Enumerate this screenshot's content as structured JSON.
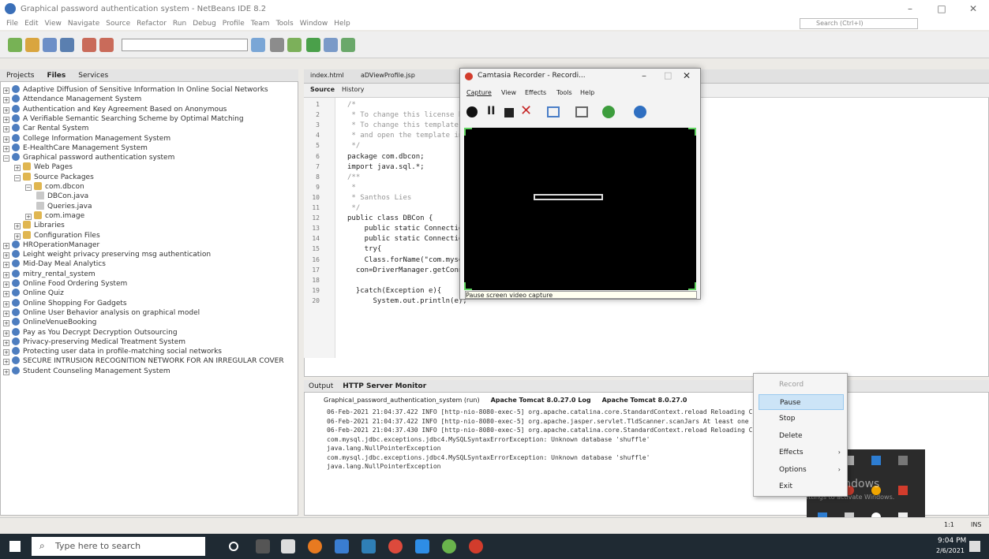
{
  "window": {
    "title": "Graphical password authentication system - NetBeans IDE 8.2"
  },
  "menu": [
    "File",
    "Edit",
    "View",
    "Navigate",
    "Source",
    "Refactor",
    "Run",
    "Debug",
    "Profile",
    "Team",
    "Tools",
    "Window",
    "Help"
  ],
  "search": {
    "placeholder": "Search (Ctrl+I)"
  },
  "projects": {
    "tabs": [
      "Projects",
      "Files",
      "Services"
    ],
    "items": [
      {
        "label": "Adaptive Diffusion of Sensitive Information In Online Social Networks",
        "level": 0
      },
      {
        "label": "Attendance Management System",
        "level": 0
      },
      {
        "label": "Authentication and Key Agreement Based on Anonymous",
        "level": 0
      },
      {
        "label": "A Verifiable Semantic Searching Scheme by Optimal Matching",
        "level": 0
      },
      {
        "label": "Car Rental System",
        "level": 0
      },
      {
        "label": "College Information Management System",
        "level": 0
      },
      {
        "label": "E-HealthCare Management System",
        "level": 0
      },
      {
        "label": "Graphical password authentication system",
        "level": 0
      },
      {
        "label": "Web Pages",
        "level": 1
      },
      {
        "label": "Source Packages",
        "level": 1
      },
      {
        "label": "com.dbcon",
        "level": 2
      },
      {
        "label": "DBCon.java",
        "level": 3
      },
      {
        "label": "Queries.java",
        "level": 3
      },
      {
        "label": "com.image",
        "level": 2
      },
      {
        "label": "Libraries",
        "level": 1
      },
      {
        "label": "Configuration Files",
        "level": 1
      },
      {
        "label": "HROperationManager",
        "level": 0
      },
      {
        "label": "Leight weight privacy preserving msg authentication",
        "level": 0
      },
      {
        "label": "Mid-Day Meal Analytics",
        "level": 0
      },
      {
        "label": "mitry_rental_system",
        "level": 0
      },
      {
        "label": "Online Food Ordering System",
        "level": 0
      },
      {
        "label": "Online Quiz",
        "level": 0
      },
      {
        "label": "Online Shopping For Gadgets",
        "level": 0
      },
      {
        "label": "Online User Behavior analysis on graphical model",
        "level": 0
      },
      {
        "label": "OnlineVenueBooking",
        "level": 0
      },
      {
        "label": "Pay as You Decrypt Decryption Outsourcing",
        "level": 0
      },
      {
        "label": "Privacy-preserving Medical Treatment System",
        "level": 0
      },
      {
        "label": "Protecting user data in profile-matching social networks",
        "level": 0
      },
      {
        "label": "SECURE INTRUSION RECOGNITION NETWORK FOR AN IRREGULAR COVER",
        "level": 0
      },
      {
        "label": "Student Counseling Management System",
        "level": 0
      }
    ]
  },
  "editor": {
    "tabs": [
      "index.html",
      "aDViewProfile.jsp"
    ],
    "subtabs": [
      "Source",
      "History"
    ],
    "lines": [
      "1",
      "2",
      "3",
      "4",
      "5",
      "6",
      "7",
      "8",
      "9",
      "10",
      "11",
      "12",
      "13",
      "14",
      "15",
      "16",
      "17",
      "18",
      "19",
      "20"
    ],
    "code": [
      {
        "t": "/*",
        "c": "cm"
      },
      {
        "t": " * To change this license header, choose License Headers in Project Properties.",
        "c": "cm"
      },
      {
        "t": " * To change this template file, choose Tools | Templates",
        "c": "cm"
      },
      {
        "t": " * and open the template in the editor.",
        "c": "cm"
      },
      {
        "t": " */",
        "c": "cm"
      },
      {
        "t": "package com.dbcon;",
        "c": ""
      },
      {
        "t": "import java.sql.*;",
        "c": ""
      },
      {
        "t": "/**",
        "c": "cm"
      },
      {
        "t": " *",
        "c": "cm"
      },
      {
        "t": " * Santhos Lies",
        "c": "cm"
      },
      {
        "t": " */",
        "c": "cm"
      },
      {
        "t": "public class DBCon {",
        "c": ""
      },
      {
        "t": "    public static Connection con;",
        "c": ""
      },
      {
        "t": "    public static Connection getConnection() {",
        "c": ""
      },
      {
        "t": "    try{",
        "c": ""
      },
      {
        "t": "    Class.forName(\"com.mysql.jdbc.Driver\");",
        "c": ""
      },
      {
        "t": "  con=DriverManager.getConnection(\"jdbc:mysql://localhost:3306/shuffle\",\"root\",\"\");",
        "c": ""
      },
      {
        "t": "",
        "c": ""
      },
      {
        "t": "  }catch(Exception e){",
        "c": ""
      },
      {
        "t": "      System.out.println(e);",
        "c": ""
      }
    ]
  },
  "output": {
    "title": "Output",
    "title2": "HTTP Server Monitor",
    "tabs": [
      "Graphical_password_authentication_system (run)",
      "Apache Tomcat 8.0.27.0 Log",
      "Apache Tomcat 8.0.27.0"
    ],
    "lines": [
      "06-Feb-2021 21:04:37.422 INFO [http-nio-8080-exec-5] org.apache.catalina.core.StandardContext.reload Reloading Context with na",
      "06-Feb-2021 21:04:37.422 INFO [http-nio-8080-exec-5] org.apache.jasper.servlet.TldScanner.scanJars At least one JAR was scanne",
      "06-Feb-2021 21:04:37.430 INFO [http-nio-8080-exec-5] org.apache.catalina.core.StandardContext.reload Reloading Context with na",
      "com.mysql.jdbc.exceptions.jdbc4.MySQLSyntaxErrorException: Unknown database 'shuffle'",
      "java.lang.NullPointerException",
      "com.mysql.jdbc.exceptions.jdbc4.MySQLSyntaxErrorException: Unknown database 'shuffle'",
      "java.lang.NullPointerException"
    ]
  },
  "camtasia": {
    "title": "Camtasia Recorder - Recordi...",
    "menu": [
      "Capture",
      "View",
      "Effects",
      "Tools",
      "Help"
    ],
    "tooltip": "Pause screen video capture"
  },
  "context_menu": {
    "items": [
      "Record",
      "Pause",
      "Stop",
      "Delete",
      "Effects",
      "Options",
      "Exit"
    ],
    "highlighted": "Pause"
  },
  "watermark": {
    "line1": "Activate Windows",
    "line2": "Go to Settings to activate Windows."
  },
  "statusbar": {
    "position": "1:1",
    "mode": "INS"
  },
  "taskbar": {
    "search": "Type here to search",
    "time": "9:04 PM",
    "date": "2/6/2021"
  },
  "colors": {
    "taskbar": "#1f2a33",
    "highlight": "#cce4f7",
    "accent": "#3a6fb8"
  }
}
